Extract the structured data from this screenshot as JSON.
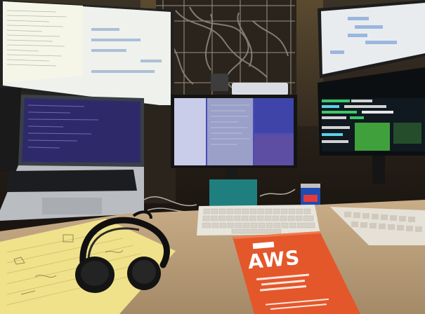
{
  "scene": {
    "kind": "photo",
    "objects": [
      "top-left-monitor",
      "top-right-monitor",
      "center-monitor",
      "laptop",
      "wire-shelf-with-cables",
      "mechanical-keyboard",
      "secondary-keyboard",
      "teal-monitor-stand",
      "soda-can",
      "headphones",
      "yellow-notepad",
      "orange-book",
      "wooden-desk"
    ]
  },
  "book": {
    "title": "AWS",
    "cover_color": "#e4572b"
  }
}
